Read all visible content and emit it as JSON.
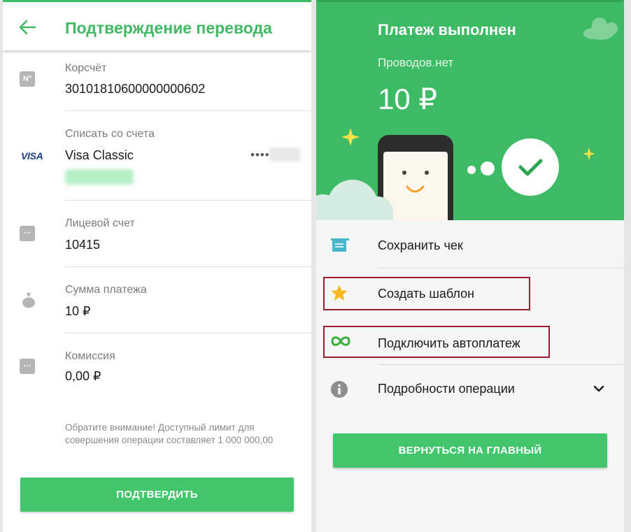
{
  "left": {
    "header": {
      "title": "Подтверждение перевода",
      "back_icon": "arrow-left-icon"
    },
    "fields": [
      {
        "label": "Корсчёт",
        "value": "30101810600000000602",
        "icon": "number-icon",
        "icon_text": "N°"
      },
      {
        "label": "Списать со счета",
        "value": "Visa Classic",
        "icon": "visa-logo",
        "icon_text": "VISA",
        "card_mask": "••••"
      },
      {
        "label": "Лицевой счет",
        "value": "10415",
        "icon": "dots-icon"
      },
      {
        "label": "Сумма платежа",
        "value": "10 ₽",
        "icon": "money-bag-icon"
      },
      {
        "label": "Комиссия",
        "value": "0,00 ₽",
        "icon": "dots-icon"
      }
    ],
    "notice": "Обратите внимание! Доступный лимит для совершения операции составляет 1 000 000,00",
    "confirm_label": "ПОДТВЕРДИТЬ"
  },
  "right": {
    "banner": {
      "title": "Платеж выполнен",
      "recipient": "Проводов.нет",
      "amount": "10 ₽"
    },
    "menu": [
      {
        "label": "Сохранить чек",
        "icon": "receipt-icon"
      },
      {
        "label": "Создать шаблон",
        "icon": "star-icon"
      },
      {
        "label": "Подключить автоплатеж",
        "icon": "infinity-icon"
      },
      {
        "label": "Подробности операции",
        "icon": "info-icon",
        "trailing_icon": "chevron-down-icon"
      }
    ],
    "home_label": "ВЕРНУТЬСЯ НА ГЛАВНЫЙ"
  },
  "colors": {
    "brand_green": "#3dbb64",
    "button_green": "#43c56c",
    "title_green": "#42b865",
    "highlight_red": "#9b1c2e",
    "visa_blue": "#1f3b87"
  }
}
